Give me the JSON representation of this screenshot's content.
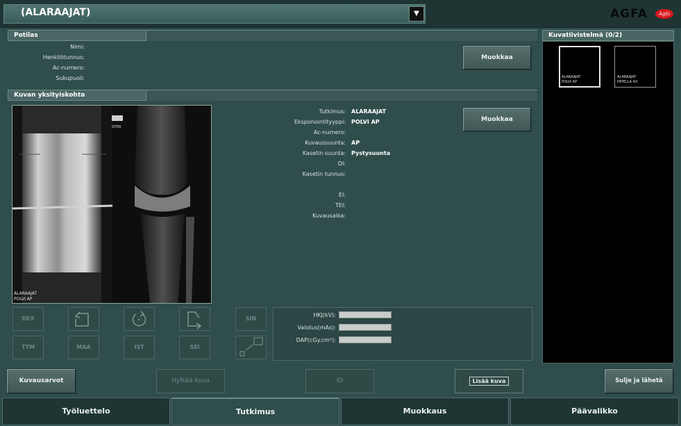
{
  "header": {
    "exam_selector_value": "(ALARAAJAT)",
    "brand": "AGFA",
    "brand_badge": "Agfa"
  },
  "patient_panel": {
    "title": "Potilas",
    "fields": [
      {
        "label": "Nimi:",
        "value": ""
      },
      {
        "label": "Henkilötunnus:",
        "value": ""
      },
      {
        "label": "Ac-numero:",
        "value": ""
      },
      {
        "label": "Sukupuoli:",
        "value": ""
      }
    ],
    "edit_label": "Muokkaa"
  },
  "image_detail_panel": {
    "title": "Kuvan yksityiskohta",
    "preview_caption_line1": "ALARAAJAT",
    "preview_caption_line2": "POLVI AP",
    "preview_marker": "STEN",
    "fields": [
      {
        "label": "Tutkimus:",
        "value": "ALARAAJAT"
      },
      {
        "label": "Eksponointityyppi:",
        "value": "POLVI AP"
      },
      {
        "label": "Ac-numero:",
        "value": ""
      },
      {
        "label": "Kuvaussuunta:",
        "value": "AP"
      },
      {
        "label": "Kasetin suunta:",
        "value": "Pystysuunta"
      },
      {
        "label": "DI:",
        "value": ""
      },
      {
        "label": "Kasetin tunnus:",
        "value": ""
      },
      {
        "label": "EI:",
        "value": ""
      },
      {
        "label": "TEI:",
        "value": ""
      },
      {
        "label": "Kuvausaika:",
        "value": ""
      }
    ],
    "edit_label": "Muokkaa",
    "tools": {
      "dex": "DEX",
      "ttm": "TTM",
      "maa": "MAA",
      "ist": "IST",
      "sei": "SEI",
      "sin": "SIN"
    },
    "exposure_fields": [
      {
        "label": "HKJ(kV):",
        "value": ""
      },
      {
        "label": "Valotus(mAs):",
        "value": ""
      },
      {
        "label": "DAP(cGy.cm²):",
        "value": ""
      }
    ]
  },
  "summary_panel": {
    "title": "Kuvatiivistelmä (0/2)",
    "thumbnails": [
      {
        "line1": "ALARAAJAT",
        "line2": "POLVI AP"
      },
      {
        "line1": "ALARAAJAT",
        "line2": "PATELLA AX"
      }
    ]
  },
  "actions": {
    "exposure_values": "Kuvausarvot",
    "reject_image": "Hylkää kuva",
    "id": "ID",
    "add_image": "Lisää kuva",
    "close_and_send": "Sulje ja lähetä kaikki"
  },
  "tabs": [
    "Työluettelo",
    "Tutkimus",
    "Muokkaus",
    "Päävalikko"
  ],
  "active_tab": "Tutkimus",
  "colors": {
    "background": "#2f4d4b",
    "topbar": "#1f3533",
    "brand_badge": "#d8181e"
  }
}
